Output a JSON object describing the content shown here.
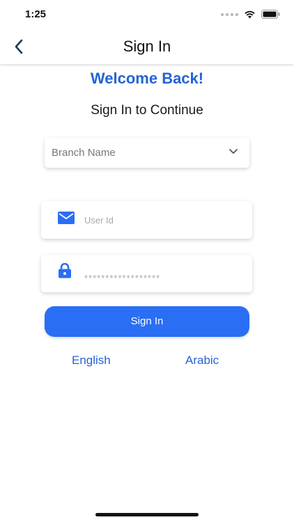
{
  "status_bar": {
    "time": "1:25"
  },
  "nav": {
    "title": "Sign In",
    "back_icon": "chevron-left-icon"
  },
  "welcome": "Welcome Back!",
  "subtitle": "Sign In to Continue",
  "branch_select": {
    "label": "Branch Name",
    "icon": "chevron-down-icon"
  },
  "user_field": {
    "placeholder": "User Id",
    "icon": "mail-icon"
  },
  "password_field": {
    "placeholder": "******************",
    "icon": "lock-icon"
  },
  "signin_button": {
    "label": "Sign In"
  },
  "languages": {
    "english": "English",
    "arabic": "Arabic"
  },
  "colors": {
    "accent": "#2463d6",
    "button": "#2a6ef5",
    "nav_icon": "#17385c"
  }
}
